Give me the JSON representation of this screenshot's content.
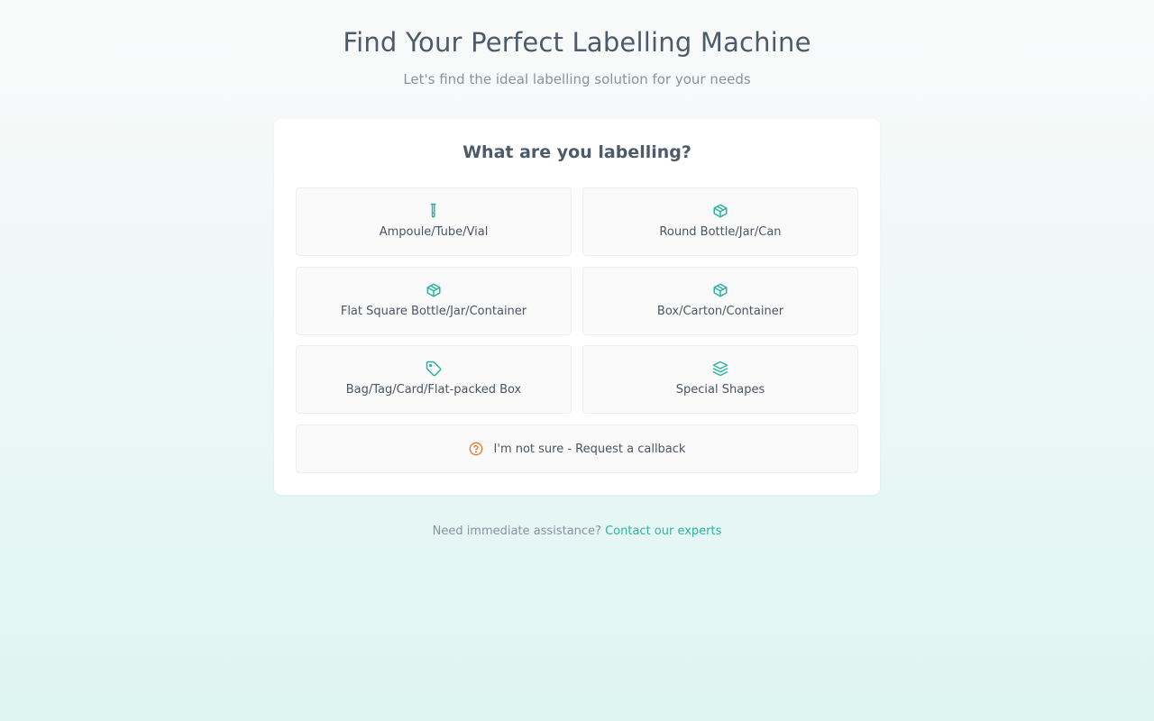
{
  "header": {
    "title": "Find Your Perfect Labelling Machine",
    "subtitle": "Let's find the ideal labelling solution for your needs"
  },
  "question": "What are you labelling?",
  "options": [
    {
      "label": "Ampoule/Tube/Vial",
      "icon": "test-tube-icon"
    },
    {
      "label": "Round Bottle/Jar/Can",
      "icon": "package-icon"
    },
    {
      "label": "Flat Square Bottle/Jar/Container",
      "icon": "package-icon"
    },
    {
      "label": "Box/Carton/Container",
      "icon": "package-icon"
    },
    {
      "label": "Bag/Tag/Card/Flat-packed Box",
      "icon": "tag-icon"
    },
    {
      "label": "Special Shapes",
      "icon": "layers-icon"
    }
  ],
  "callback": {
    "label": "I'm not sure - Request a callback",
    "icon": "help-circle-icon"
  },
  "footer": {
    "text": "Need immediate assistance?",
    "link": "Contact our experts"
  },
  "colors": {
    "accent": "#2db3a0",
    "callback_icon": "#e8772e"
  }
}
